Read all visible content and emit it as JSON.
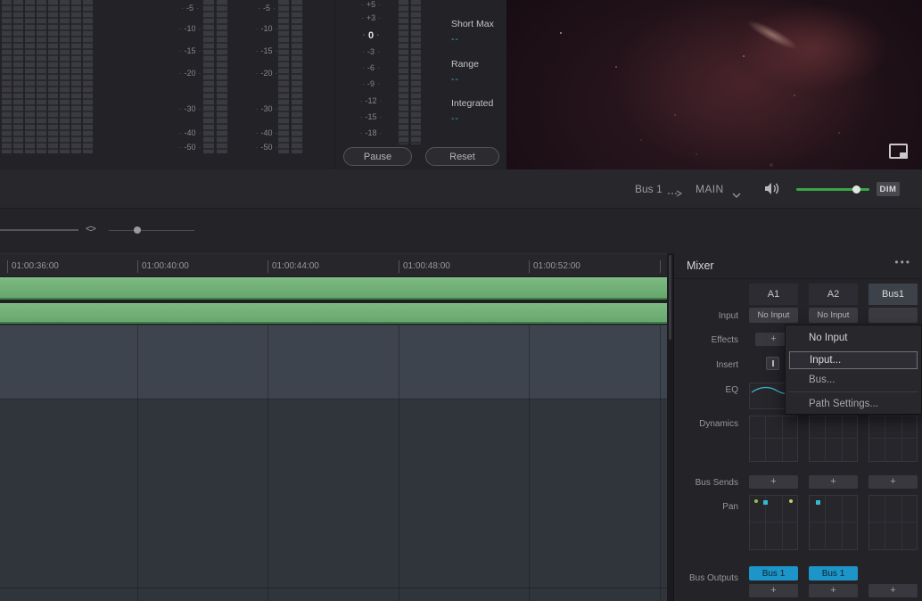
{
  "meters": {
    "scale_labels": [
      "-5",
      "-10",
      "-15",
      "-20",
      "-30",
      "-40",
      "-50"
    ],
    "loudness_scale": [
      "+5",
      "+3",
      "0",
      "-3",
      "-6",
      "-9",
      "-12",
      "-15",
      "-18"
    ],
    "loudness_stats": [
      {
        "label": "Short Max",
        "value": "--"
      },
      {
        "label": "Range",
        "value": "--"
      },
      {
        "label": "Integrated",
        "value": "--"
      }
    ],
    "pause_label": "Pause",
    "reset_label": "Reset"
  },
  "monitor": {
    "source": "Bus 1",
    "target": "MAIN",
    "dim_label": "DIM"
  },
  "timeline": {
    "ruler_labels": [
      "01:00:36:00",
      "01:00:40:00",
      "01:00:44:00",
      "01:00:48:00",
      "01:00:52:00"
    ]
  },
  "mixer": {
    "title": "Mixer",
    "menu_icon": "•••",
    "row_labels": [
      "Input",
      "Effects",
      "Insert",
      "EQ",
      "Dynamics",
      "Bus Sends",
      "Pan",
      "Bus Outputs"
    ],
    "plus_label": "+",
    "channels": [
      {
        "name": "A1",
        "input": "No Input",
        "bus_output": "Bus 1"
      },
      {
        "name": "A2",
        "input": "No Input",
        "bus_output": "Bus 1"
      },
      {
        "name": "Bus1",
        "input": "",
        "bus_output": ""
      }
    ]
  },
  "context_menu": {
    "items": [
      {
        "label": "No Input"
      },
      {
        "label": "Input..."
      },
      {
        "label": "Bus..."
      },
      {
        "label": "Path Settings..."
      }
    ]
  },
  "colors": {
    "accent_teal": "#2fb7ce",
    "accent_green": "#3aa648",
    "bus_button_cyan": "#1e95c9",
    "clip_green": "#6fae74"
  },
  "zoom_icon": "<>"
}
